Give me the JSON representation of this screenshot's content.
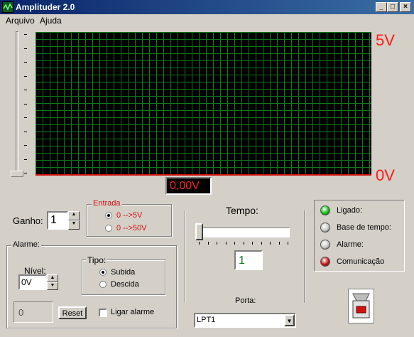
{
  "window": {
    "title": "Amplituder 2.0",
    "minimize_label": "_",
    "maximize_label": "□",
    "close_label": "×"
  },
  "menu": [
    {
      "label": "Arquivo"
    },
    {
      "label": "Ajuda"
    }
  ],
  "scope": {
    "max_label": "5V",
    "min_label": "0V",
    "reading": "0,00V"
  },
  "ganho": {
    "label": "Ganho:",
    "value": "1"
  },
  "entrada": {
    "legend": "Entrada",
    "options": [
      "0 -->5V",
      "0 -->50V"
    ],
    "selected": 0
  },
  "alarme": {
    "legend": "Alarme:",
    "nivel_label": "Nível:",
    "nivel_value": "0V",
    "tipo_legend": "Tipo:",
    "tipo_options": [
      "Subida",
      "Descida"
    ],
    "tipo_selected": 0,
    "counter_value": "0",
    "reset_label": "Reset",
    "ligar_label": "Ligar alarme"
  },
  "tempo": {
    "label": "Tempo:",
    "value": "1",
    "slider_level": 0
  },
  "porta": {
    "label": "Porta:",
    "value": "LPT1"
  },
  "status": [
    {
      "label": "Ligado:",
      "color": "#10c010"
    },
    {
      "label": "Base de tempo:",
      "color": "#c8c8c8"
    },
    {
      "label": "Alarme:",
      "color": "#c8c8c8"
    },
    {
      "label": "Comunicação",
      "color": "#c01010"
    }
  ],
  "colors": {
    "titlebar": "#0a246a",
    "grid": "#0c7a18",
    "scale": "#ff1a1a",
    "display_bg": "#000000"
  }
}
